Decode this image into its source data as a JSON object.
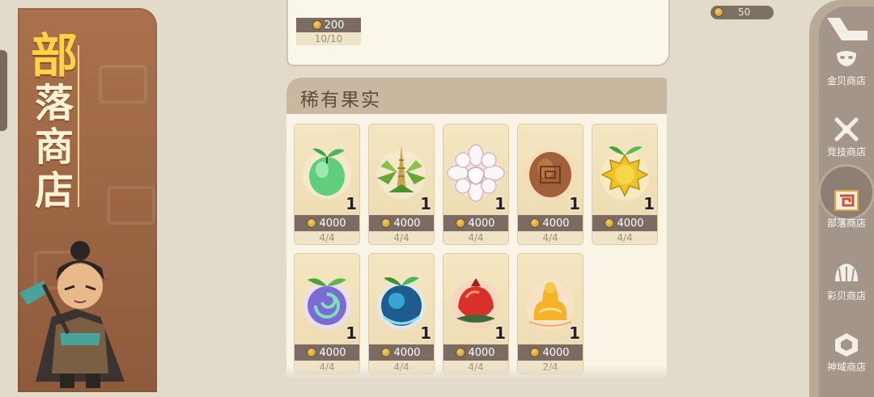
{
  "banner": {
    "title_chars": [
      "部",
      "落",
      "商",
      "店"
    ]
  },
  "currency": {
    "icon": "coin-icon",
    "amount": "50"
  },
  "previous_item": {
    "price": "200",
    "stock": "10/10"
  },
  "rare_fruits": {
    "title": "稀有果实",
    "items": [
      {
        "icon": "green-fruit-icon",
        "qty": "1",
        "price": "4000",
        "stock": "4/4"
      },
      {
        "icon": "bamboo-sprout-icon",
        "qty": "1",
        "price": "4000",
        "stock": "4/4"
      },
      {
        "icon": "white-flower-icon",
        "qty": "1",
        "price": "4000",
        "stock": "4/4"
      },
      {
        "icon": "brown-nut-icon",
        "qty": "1",
        "price": "4000",
        "stock": "4/4"
      },
      {
        "icon": "spiky-yellow-fruit-icon",
        "qty": "1",
        "price": "4000",
        "stock": "4/4"
      },
      {
        "icon": "swirl-purple-fruit-icon",
        "qty": "1",
        "price": "4000",
        "stock": "4/4"
      },
      {
        "icon": "blue-fruit-icon",
        "qty": "1",
        "price": "4000",
        "stock": "4/4"
      },
      {
        "icon": "red-pomegranate-icon",
        "qty": "1",
        "price": "4000",
        "stock": "4/4"
      },
      {
        "icon": "golden-fruit-icon",
        "qty": "1",
        "price": "4000",
        "stock": "2/4"
      }
    ]
  },
  "side_nav": {
    "back_icon": "back-arrow-icon",
    "items": [
      {
        "label": "金贝商店",
        "icon": "mask-icon",
        "active": false
      },
      {
        "label": "竞技商店",
        "icon": "crossed-swords-icon",
        "active": false
      },
      {
        "label": "部落商店",
        "icon": "tribal-emblem-icon",
        "active": true
      },
      {
        "label": "彩贝商店",
        "icon": "shell-icon",
        "active": false
      },
      {
        "label": "神域商店",
        "icon": "hexagon-gem-icon",
        "active": false
      }
    ]
  }
}
